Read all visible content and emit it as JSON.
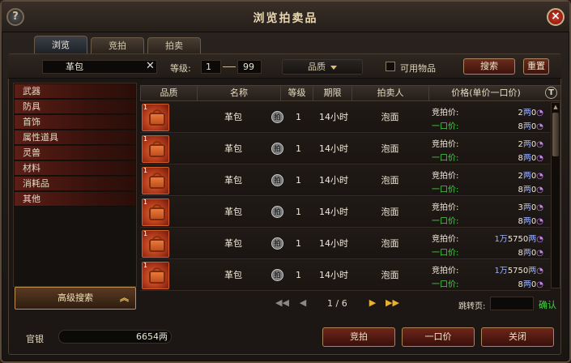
{
  "window": {
    "title": "浏览拍卖品"
  },
  "tabs": [
    {
      "label": "浏览"
    },
    {
      "label": "竞拍"
    },
    {
      "label": "拍卖"
    }
  ],
  "filter": {
    "search_value": "革包",
    "level_label": "等级:",
    "level_min": "1",
    "level_max": "99",
    "quality_label": "品质",
    "usable_label": "可用物品",
    "search_button": "搜索",
    "reset_button": "重置"
  },
  "categories": [
    {
      "label": "武器"
    },
    {
      "label": "防具"
    },
    {
      "label": "首饰"
    },
    {
      "label": "属性道具"
    },
    {
      "label": "灵兽"
    },
    {
      "label": "材料"
    },
    {
      "label": "消耗品"
    },
    {
      "label": "其他"
    }
  ],
  "advanced_search": "高级搜索",
  "table": {
    "headers": {
      "quality": "品质",
      "name": "名称",
      "level": "等级",
      "duration": "期限",
      "seller": "拍卖人",
      "price": "价格(单价一口价)"
    },
    "bid_label": "竞拍价:",
    "buyout_label": "一口价:",
    "bid_icon_text": "拍",
    "rows": [
      {
        "num": "1",
        "name": "革包",
        "level": "1",
        "duration": "14小时",
        "seller": "泡面",
        "bid_pre": "",
        "bid_num": "2",
        "bid_unit": "两",
        "bid_tail": "0",
        "buy_pre": "",
        "buy_num": "8",
        "buy_unit": "两",
        "buy_tail": "0"
      },
      {
        "num": "1",
        "name": "革包",
        "level": "1",
        "duration": "14小时",
        "seller": "泡面",
        "bid_pre": "",
        "bid_num": "2",
        "bid_unit": "两",
        "bid_tail": "0",
        "buy_pre": "",
        "buy_num": "8",
        "buy_unit": "两",
        "buy_tail": "0"
      },
      {
        "num": "1",
        "name": "革包",
        "level": "1",
        "duration": "14小时",
        "seller": "泡面",
        "bid_pre": "",
        "bid_num": "2",
        "bid_unit": "两",
        "bid_tail": "0",
        "buy_pre": "",
        "buy_num": "8",
        "buy_unit": "两",
        "buy_tail": "0"
      },
      {
        "num": "1",
        "name": "革包",
        "level": "1",
        "duration": "14小时",
        "seller": "泡面",
        "bid_pre": "",
        "bid_num": "3",
        "bid_unit": "两",
        "bid_tail": "0",
        "buy_pre": "",
        "buy_num": "8",
        "buy_unit": "两",
        "buy_tail": "0"
      },
      {
        "num": "1",
        "name": "革包",
        "level": "1",
        "duration": "14小时",
        "seller": "泡面",
        "bid_pre": "1万",
        "bid_num": "5750",
        "bid_unit": "两",
        "bid_tail": "",
        "buy_pre": "",
        "buy_num": "8",
        "buy_unit": "两",
        "buy_tail": "0"
      },
      {
        "num": "1",
        "name": "革包",
        "level": "1",
        "duration": "14小时",
        "seller": "泡面",
        "bid_pre": "1万",
        "bid_num": "5750",
        "bid_unit": "两",
        "bid_tail": "",
        "buy_pre": "",
        "buy_num": "8",
        "buy_unit": "两",
        "buy_tail": "0"
      }
    ]
  },
  "pager": {
    "page": "1 / 6",
    "jump_label": "跳转页:",
    "confirm": "确认"
  },
  "footer": {
    "silver_label": "官银",
    "silver_value": "6654两",
    "bid_button": "竞拍",
    "buyout_button": "一口价",
    "close_button": "关闭"
  },
  "colors": {
    "accent_red": "#6a2a1c",
    "gold": "#e8b030",
    "green": "#4ad04a"
  }
}
